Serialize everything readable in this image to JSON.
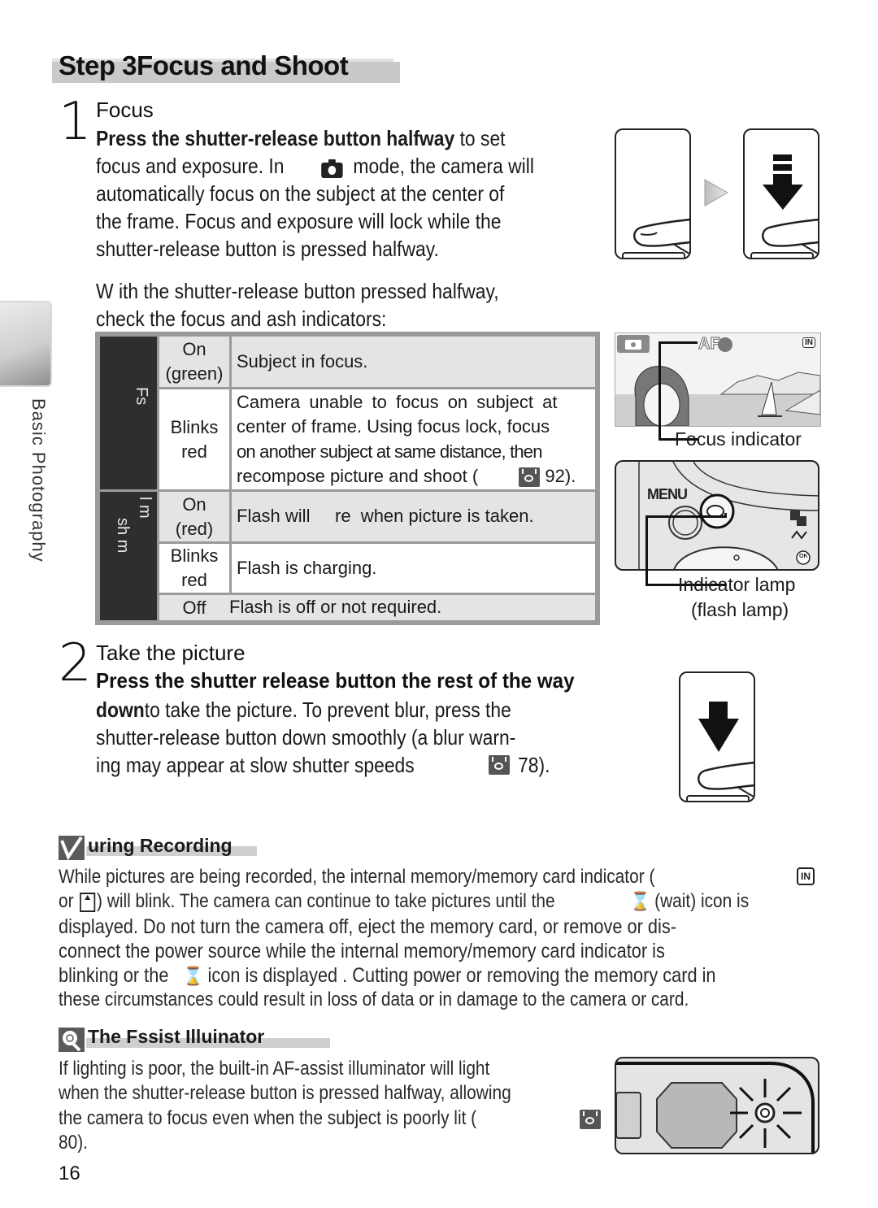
{
  "page": {
    "title": "Step 3Focus and Shoot",
    "side_tab_label": "Basic Photography",
    "page_number": "16"
  },
  "step1": {
    "number": "1",
    "heading": "Focus",
    "lines": [
      {
        "bold": "Press   the shutter-release   button   halfway",
        "rest": "to set"
      },
      {
        "text_before_icon": "focus and exposure.   In",
        "icon": "camera-icon",
        "text_after_icon": "mode, the camera will"
      },
      {
        "text": "automatically focus on the subject at the center of"
      },
      {
        "text": "the frame.  Focus and exposure will lock while the"
      },
      {
        "text": "shutter-release button is pressed halfway."
      }
    ],
    "check_lines": [
      "W ith  the  shutter-release  button  pressed  halfway,",
      "check the focus and        ash indicators:"
    ]
  },
  "indicator_table": {
    "groups": [
      {
        "label": "Fs",
        "rows": [
          {
            "state": "On\n(green)",
            "state_lines": [
              "On",
              "(green)"
            ],
            "description_lines": [
              "Subject in focus."
            ]
          },
          {
            "state_lines": [
              "Blinks",
              "red"
            ],
            "description_lines": [
              "Camera  unable  to  focus  on  subject  at",
              "center of frame.  Using focus lock, focus",
              "on another subject at same distance, then",
              "recompose picture and shoot (",
              "92)."
            ],
            "ref_icon": "eye-reference-icon",
            "ref_page": "92"
          }
        ]
      },
      {
        "label_lines": [
          "l m",
          "sh m"
        ],
        "rows": [
          {
            "state_lines": [
              "On",
              "(red)"
            ],
            "description_lines": [
              "Flash will     re  when picture is taken."
            ]
          },
          {
            "state_lines": [
              "Blinks",
              "red"
            ],
            "description_lines": [
              "Flash is charging."
            ]
          },
          {
            "state_lines": [
              "Off"
            ],
            "description_lines": [
              "Flash is off or not required."
            ]
          }
        ]
      }
    ]
  },
  "illustrations": {
    "focus_indicator_label": "Focus indicator",
    "af_text": "AF",
    "memory_icon_text": "IN",
    "menu_text": "MENU",
    "ok_text": "OK",
    "indicator_lamp_label_1": "Indicator lamp",
    "indicator_lamp_label_2": "(flash lamp)"
  },
  "step2": {
    "number": "2",
    "heading": "Take the picture",
    "bold_line": "Press the shutter release button the rest of the way",
    "bold_word": "down",
    "line1_rest": "to take the picture.  To prevent blur, press the",
    "line2": "shutter-release button down smoothly (a blur warn-",
    "line3": "ing may appear at slow shutter speeds",
    "ref_page": "78)."
  },
  "note_recording": {
    "heading": "uring Recording",
    "icon": "checkmark-icon",
    "lines": [
      {
        "text": "While  pictures  are  being  recorded,  the  internal  memory/memory  card  indicator  (",
        "icon": "internal-memory-icon"
      },
      {
        "pre": "or",
        "icon": "memory-card-icon",
        "mid": ") will blink.  The camera can continue to take pictures until the",
        "icon2": "hourglass-icon",
        "post": "(wait) icon is"
      },
      {
        "text": "displayed.    Do not turn the camera off, eject the memory card, or remove or dis-"
      },
      {
        "text": "connect the power source while the internal memory/memory card indicator is"
      },
      {
        "pre": "blinking or the",
        "icon": "hourglass-icon",
        "post": "icon is displayed   .  Cutting power or removing the memory card in"
      },
      {
        "text": "these circumstances could result in loss of data or in damage to the camera or card."
      }
    ]
  },
  "note_af": {
    "heading": "The Fssist Illuinator",
    "icon": "lamp-icon",
    "lines": [
      "If  lighting  is  poor,  the  built-in  AF-assist  illuminator  will  light",
      "when  the  shutter-release  button  is  pressed  halfway,  allowing",
      "the  camera  to  focus  even  when  the  subject  is  poorly  lit  (",
      "80)."
    ]
  },
  "colors": {
    "table_dark": "#2e2e2e",
    "table_grey": "#e4e4e4",
    "table_border": "#9a9a9a",
    "title_bar": "#c9c9c9"
  }
}
